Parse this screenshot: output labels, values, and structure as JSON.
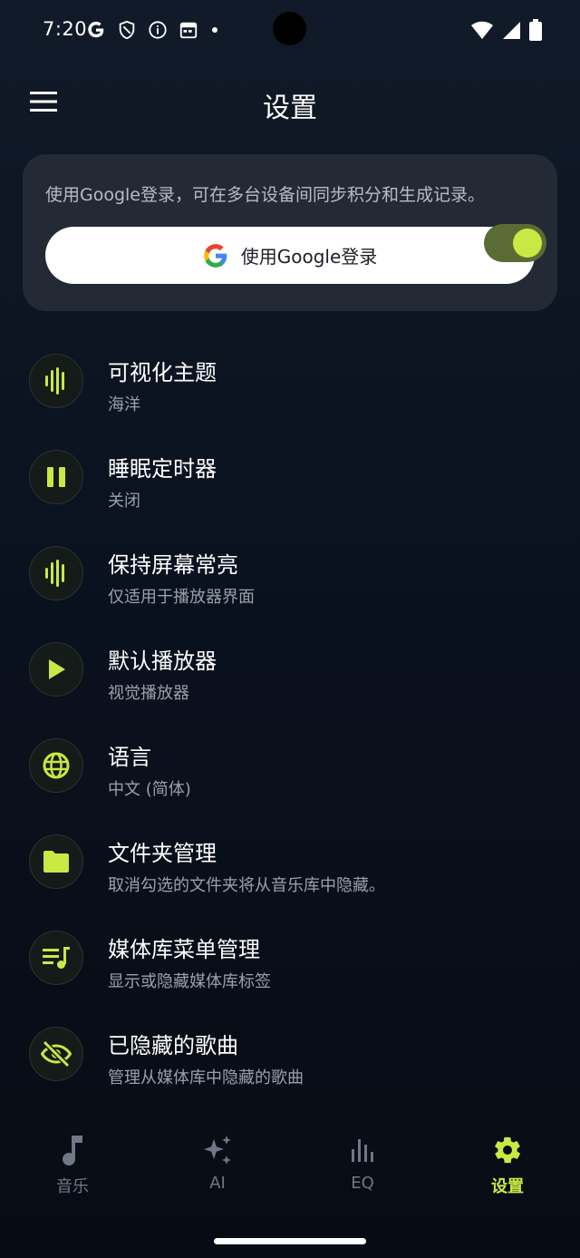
{
  "status_bar": {
    "time": "7:20"
  },
  "app_bar": {
    "title": "设置"
  },
  "login_card": {
    "description": "使用Google登录，可在多台设备间同步积分和生成记录。",
    "button_label": "使用Google登录"
  },
  "settings": [
    {
      "title": "可视化主题",
      "subtitle": "海洋",
      "icon": "waveform-icon"
    },
    {
      "title": "睡眠定时器",
      "subtitle": "关闭",
      "icon": "pause-icon"
    },
    {
      "title": "保持屏幕常亮",
      "subtitle": "仅适用于播放器界面",
      "icon": "waveform-icon",
      "toggle_on": true
    },
    {
      "title": "默认播放器",
      "subtitle": "视觉播放器",
      "icon": "play-icon"
    },
    {
      "title": "语言",
      "subtitle": "中文 (简体)",
      "icon": "globe-icon"
    },
    {
      "title": "文件夹管理",
      "subtitle": "取消勾选的文件夹将从音乐库中隐藏。",
      "icon": "folder-icon"
    },
    {
      "title": "媒体库菜单管理",
      "subtitle": "显示或隐藏媒体库标签",
      "icon": "playlist-icon"
    },
    {
      "title": "已隐藏的歌曲",
      "subtitle": "管理从媒体库中隐藏的歌曲",
      "icon": "eye-off-icon"
    }
  ],
  "bottom_nav": [
    {
      "label": "音乐",
      "icon": "music-note-icon",
      "active": false
    },
    {
      "label": "AI",
      "icon": "sparkles-icon",
      "active": false
    },
    {
      "label": "EQ",
      "icon": "equalizer-icon",
      "active": false
    },
    {
      "label": "设置",
      "icon": "gear-icon",
      "active": true
    }
  ],
  "colors": {
    "accent": "#c9e844",
    "background": "#0b1220",
    "card": "#232a35",
    "toggle_track": "#5a6b33"
  }
}
